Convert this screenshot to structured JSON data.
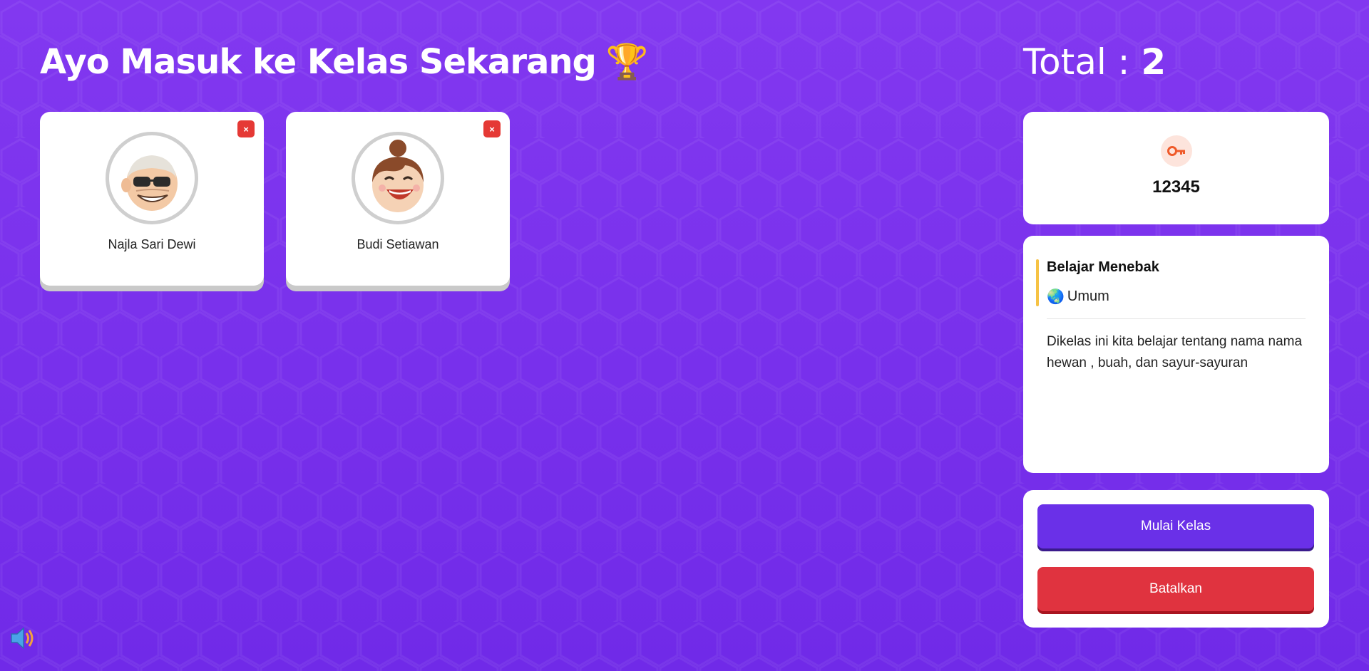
{
  "header": {
    "title": "Ayo Masuk ke Kelas Sekarang",
    "title_emoji": "🏆",
    "total_label": "Total :",
    "total_value": "2"
  },
  "participants": [
    {
      "name": "Najla Sari Dewi",
      "avatar": "avatar-cool-grandpa-sunglasses",
      "remove_label": "×"
    },
    {
      "name": "Budi Setiawan",
      "avatar": "avatar-laughing-woman-bun",
      "remove_label": "×"
    }
  ],
  "room": {
    "code_icon": "key-icon",
    "code": "12345"
  },
  "class_info": {
    "title": "Belajar Menebak",
    "category_icon": "🌏",
    "category": "Umum",
    "description": "Dikelas ini kita belajar tentang nama nama hewan , buah, dan sayur-sayuran"
  },
  "actions": {
    "start_label": "Mulai Kelas",
    "cancel_label": "Batalkan"
  },
  "sound_icon": "speaker-icon",
  "colors": {
    "background": "#7a34ec",
    "start_button": "#6a30e8",
    "cancel_button": "#e0333f",
    "accent": "#f6c244",
    "remove_button": "#e53935"
  }
}
